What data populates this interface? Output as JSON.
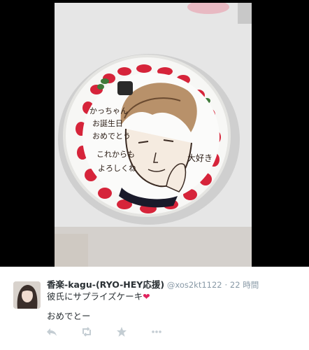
{
  "tweet": {
    "display_name": "香楽-kagu-(RYO-HEY応援)",
    "handle": "@xos2kt1122",
    "separator": "·",
    "time": "22 時間",
    "text_line1": "彼氏にサプライズケーキ",
    "heart": "❤",
    "text_line2": "おめでとー"
  },
  "photo": {
    "cake_message_lines": [
      "かっちゃん",
      "お誕生日",
      "おめでとう",
      "これからも",
      "よろしくね"
    ],
    "cake_signature": "大好き"
  },
  "actions": [
    "reply-icon",
    "retweet-icon",
    "favorite-icon",
    "more-icon"
  ],
  "colors": {
    "name": "#292f33",
    "meta": "#8899a6",
    "heart": "#e0245e",
    "action": "#c4cdd3"
  }
}
